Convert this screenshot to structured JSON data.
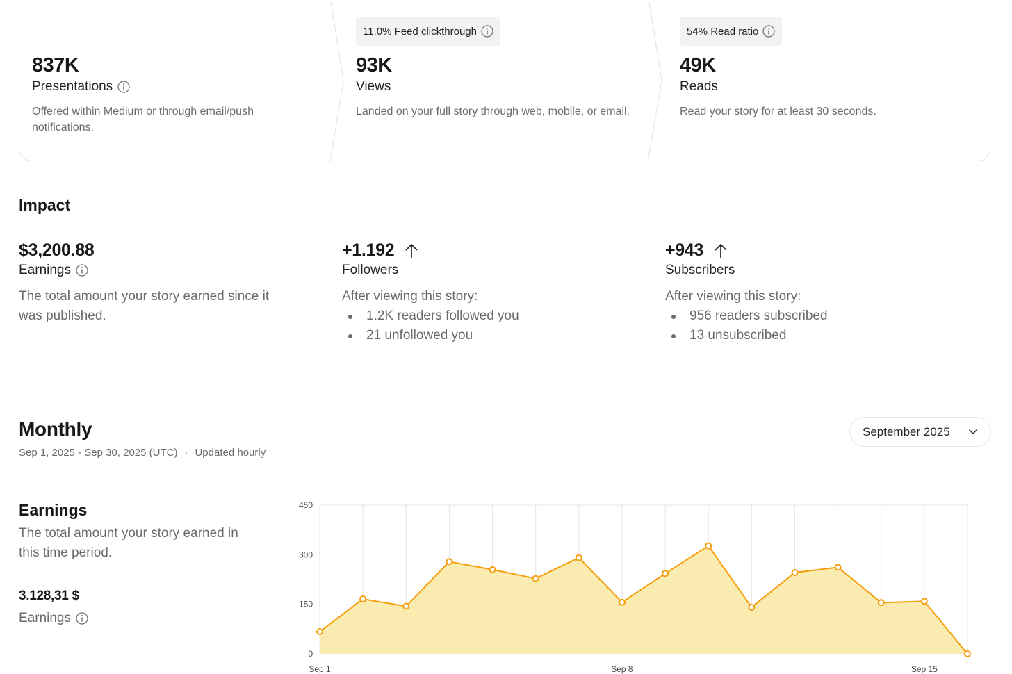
{
  "funnel": {
    "presentations": {
      "value": "837K",
      "label": "Presentations",
      "description": "Offered within Medium or through email/push notifications."
    },
    "views": {
      "badge": "11.0% Feed clickthrough",
      "value": "93K",
      "label": "Views",
      "description": "Landed on your full story through web, mobile, or email."
    },
    "reads": {
      "badge": "54% Read ratio",
      "value": "49K",
      "label": "Reads",
      "description": "Read your story for at least 30 seconds."
    }
  },
  "impact": {
    "title": "Impact",
    "earnings": {
      "value": "$3,200.88",
      "label": "Earnings",
      "description": "The total amount your story earned since it was published."
    },
    "followers": {
      "value": "+1.192",
      "label": "Followers",
      "intro": "After viewing this story:",
      "bullets": [
        "1.2K readers followed you",
        "21 unfollowed you"
      ]
    },
    "subscribers": {
      "value": "+943",
      "label": "Subscribers",
      "intro": "After viewing this story:",
      "bullets": [
        "956 readers subscribed",
        "13 unsubscribed"
      ]
    }
  },
  "monthly": {
    "title": "Monthly",
    "range": "Sep 1, 2025 - Sep 30, 2025 (UTC)",
    "separator": "·",
    "updated": "Updated hourly",
    "period_selector": "September 2025",
    "earnings": {
      "title": "Earnings",
      "description": "The total amount your story earned in this time period.",
      "value": "3.128,31 $",
      "label": "Earnings"
    }
  },
  "colors": {
    "line": "#f59e0b",
    "fill": "#faecb0",
    "grid": "#e5e5e5"
  },
  "chart_data": {
    "type": "area",
    "x": [
      "Sep 1",
      "Sep 2",
      "Sep 3",
      "Sep 4",
      "Sep 5",
      "Sep 6",
      "Sep 7",
      "Sep 8",
      "Sep 9",
      "Sep 10",
      "Sep 11",
      "Sep 12",
      "Sep 13",
      "Sep 14",
      "Sep 15",
      "Sep 16"
    ],
    "values": [
      67,
      166,
      144,
      279,
      255,
      228,
      291,
      156,
      243,
      327,
      141,
      246,
      262,
      155,
      159,
      0
    ],
    "x_tick_labels": [
      {
        "index": 0,
        "label": "Sep 1"
      },
      {
        "index": 7,
        "label": "Sep 8"
      },
      {
        "index": 14,
        "label": "Sep 15"
      }
    ],
    "yticks": [
      0,
      150,
      300,
      450
    ],
    "ylim": [
      0,
      450
    ],
    "grid": "vertical",
    "legend": "none"
  }
}
